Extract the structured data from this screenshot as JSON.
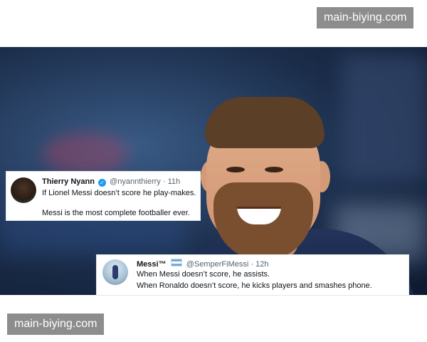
{
  "watermarks": {
    "top": "main-biying.com",
    "bottom": "main-biying.com"
  },
  "tweets": [
    {
      "name": "Thierry Nyann",
      "verified": true,
      "handle": "@nyannthierry",
      "separator": "·",
      "time": "11h",
      "lines": [
        "If Lionel Messi doesn’t score he play-makes.",
        "Messi is the most complete footballer ever."
      ]
    },
    {
      "name": "Messi™",
      "flag_icon": "argentina-flag-icon",
      "handle": "@SemperFiMessi",
      "separator": "·",
      "time": "12h",
      "lines": [
        "When Messi doesn’t score, he assists.",
        "When Ronaldo doesn’t score, he kicks players and smashes phone."
      ]
    }
  ],
  "colors": {
    "verified_badge": "#1d9bf0",
    "watermark_bg": "#8d8d8d"
  }
}
